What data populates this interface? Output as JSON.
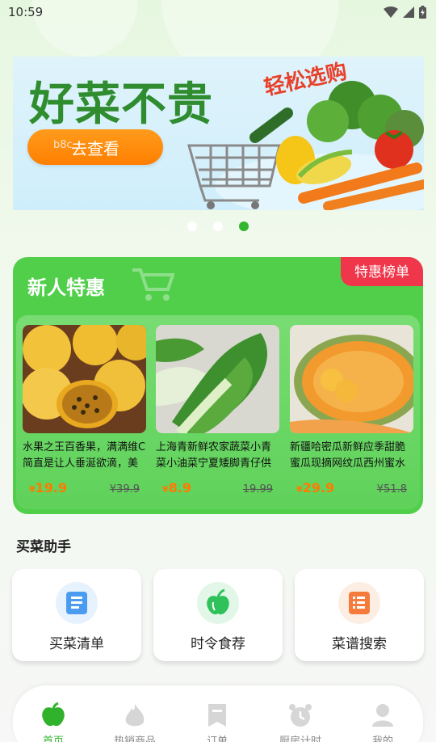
{
  "status_bar": {
    "time": "10:59"
  },
  "banner": {
    "title": "好菜不贵",
    "tag": "轻松选购",
    "button_label": "去查看",
    "watermark": "b8c"
  },
  "carousel": {
    "count": 3,
    "active_index": 2
  },
  "promo": {
    "title": "新人特惠",
    "rank_label": "特惠榜单",
    "products": [
      {
        "name": "水果之王百香果，满满维C简直是让人垂涎欲滴，美",
        "price_symbol": "¥",
        "price": "19.9",
        "old_price": "¥39.9"
      },
      {
        "name": "上海青新鲜农家蔬菜小青菜小油菜宁夏矮脚青仔供",
        "price_symbol": "¥",
        "price": "8.9",
        "old_price": "19.99"
      },
      {
        "name": "新疆哈密瓜新鲜应季甜脆蜜瓜现摘网纹瓜西州蜜水",
        "price_symbol": "¥",
        "price": "29.9",
        "old_price": "¥51.8"
      }
    ]
  },
  "assistant": {
    "title": "买菜助手",
    "items": [
      {
        "label": "买菜清单",
        "icon": "shopping-list-icon",
        "color": "#4a9cf0"
      },
      {
        "label": "时令食荐",
        "icon": "seasonal-apple-icon",
        "color": "#2fc25b"
      },
      {
        "label": "菜谱搜索",
        "icon": "recipe-search-icon",
        "color": "#f57a3c"
      }
    ]
  },
  "bottom_nav": {
    "items": [
      {
        "label": "首页",
        "icon": "home-icon",
        "active": true
      },
      {
        "label": "热销商品",
        "icon": "hot-products-icon",
        "active": false
      },
      {
        "label": "订单",
        "icon": "orders-icon",
        "active": false
      },
      {
        "label": "厨房计时",
        "icon": "kitchen-timer-icon",
        "active": false
      },
      {
        "label": "我的",
        "icon": "profile-icon",
        "active": false
      }
    ]
  },
  "colors": {
    "accent": "#32b52f",
    "price": "#ff7a00",
    "rank_badge": "#f0364a",
    "button": "#ff8a0a"
  }
}
